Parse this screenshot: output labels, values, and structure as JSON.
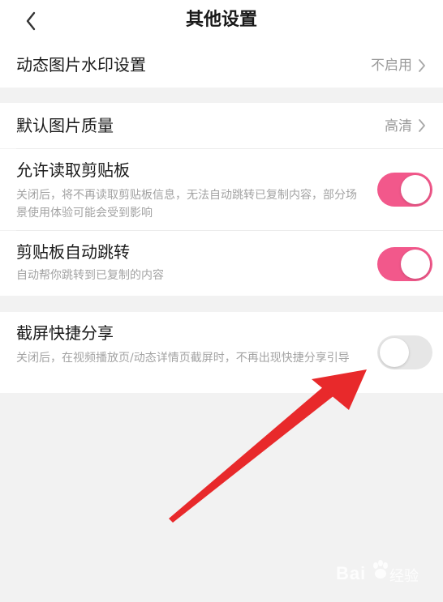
{
  "header": {
    "title": "其他设置",
    "back_icon": "chevron-left-icon"
  },
  "watermark": {
    "logo": "Bai",
    "sub": "经验"
  },
  "colors": {
    "toggle_on": "#f2588b",
    "toggle_off": "#e6e6e6",
    "annotation_arrow": "#e8292b"
  },
  "settings": {
    "watermark_setting": {
      "title": "动态图片水印设置",
      "value": "不启用"
    },
    "image_quality": {
      "title": "默认图片质量",
      "value": "高清"
    },
    "clipboard_read": {
      "title": "允许读取剪贴板",
      "desc": "关闭后，将不再读取剪贴板信息，无法自动跳转已复制内容，部分场景使用体验可能会受到影响",
      "enabled": true
    },
    "clipboard_jump": {
      "title": "剪贴板自动跳转",
      "desc": "自动帮你跳转到已复制的内容",
      "enabled": true
    },
    "screenshot_share": {
      "title": "截屏快捷分享",
      "desc": "关闭后，在视频播放页/动态详情页截屏时，不再出现快捷分享引导",
      "enabled": false
    }
  }
}
